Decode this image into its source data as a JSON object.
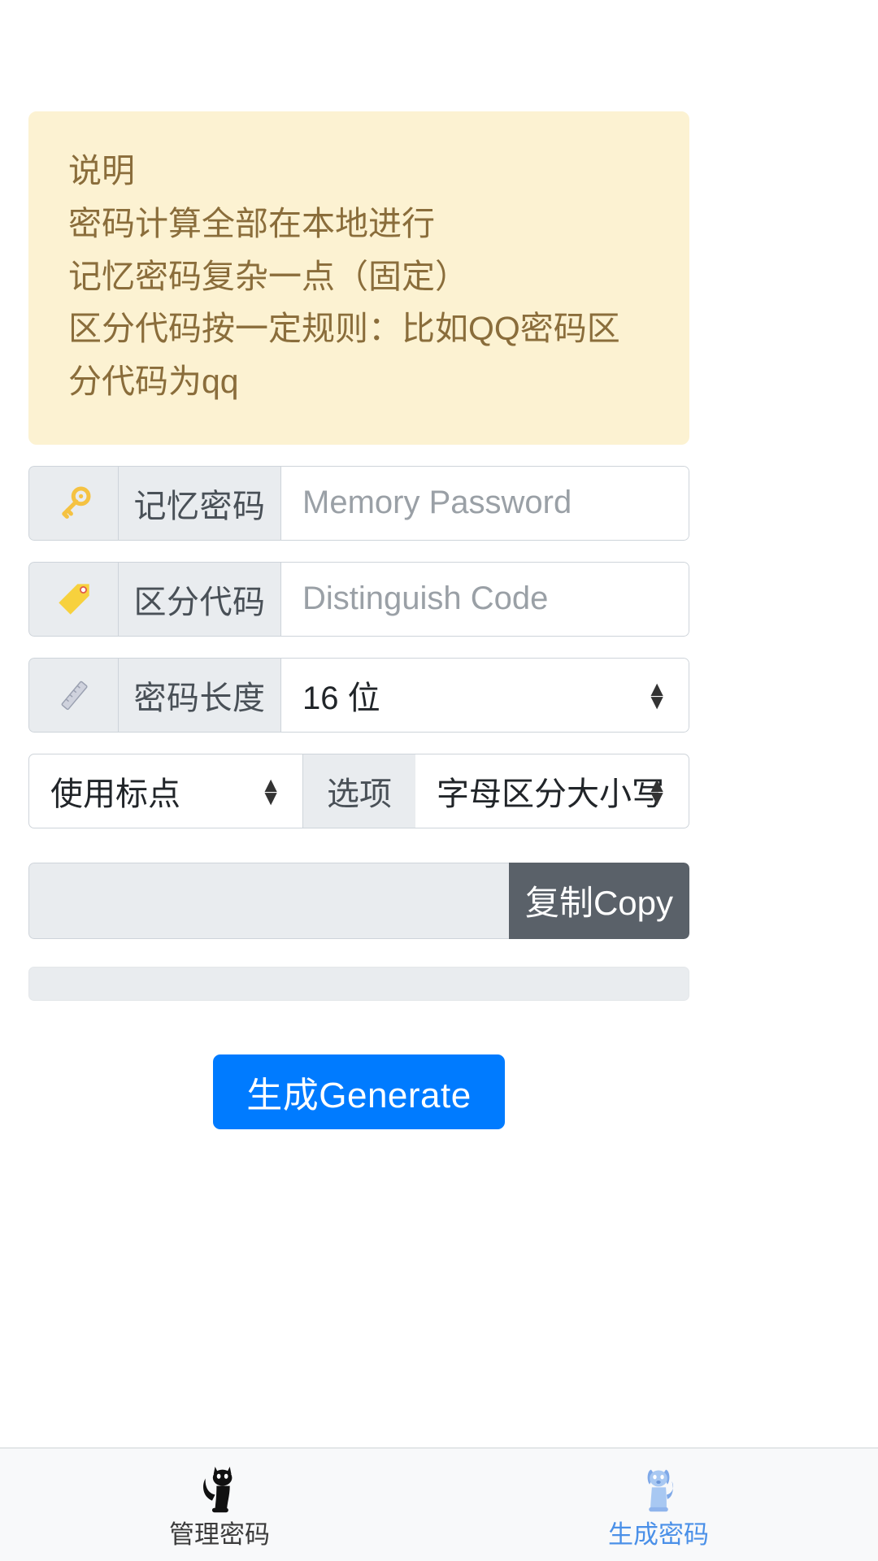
{
  "alert": {
    "lines": [
      "说明",
      "密码计算全部在本地进行",
      "记忆密码复杂一点（固定）",
      "区分代码按一定规则：比如QQ密码区分代码为qq"
    ]
  },
  "form": {
    "memory_password": {
      "icon": "key-icon",
      "label": "记忆密码",
      "placeholder": "Memory Password",
      "value": ""
    },
    "distinguish_code": {
      "icon": "tag-icon",
      "label": "区分代码",
      "placeholder": "Distinguish Code",
      "value": ""
    },
    "password_length": {
      "icon": "ruler-icon",
      "label": "密码长度",
      "value": "16 位",
      "options": [
        "16 位"
      ]
    },
    "options_row": {
      "punctuation_select": {
        "value": "使用标点",
        "options": [
          "使用标点"
        ]
      },
      "middle_label": "选项",
      "case_select": {
        "value": "字母区分大小写",
        "options": [
          "字母区分大小写"
        ]
      }
    },
    "result": {
      "value": "",
      "copy_label": "复制Copy"
    },
    "secondary_result": {
      "value": ""
    },
    "generate_label": "生成Generate"
  },
  "colors": {
    "alert_bg": "#fcf2d2",
    "alert_text": "#8a6d3b",
    "primary": "#007bff",
    "copy_button": "#5a6169",
    "tab_active": "#4a90e8",
    "tab_inactive": "#3b3b3b"
  },
  "tabbar": {
    "tabs": [
      {
        "icon": "cat-icon",
        "label": "管理密码",
        "active": false
      },
      {
        "icon": "dog-icon",
        "label": "生成密码",
        "active": true
      }
    ]
  }
}
